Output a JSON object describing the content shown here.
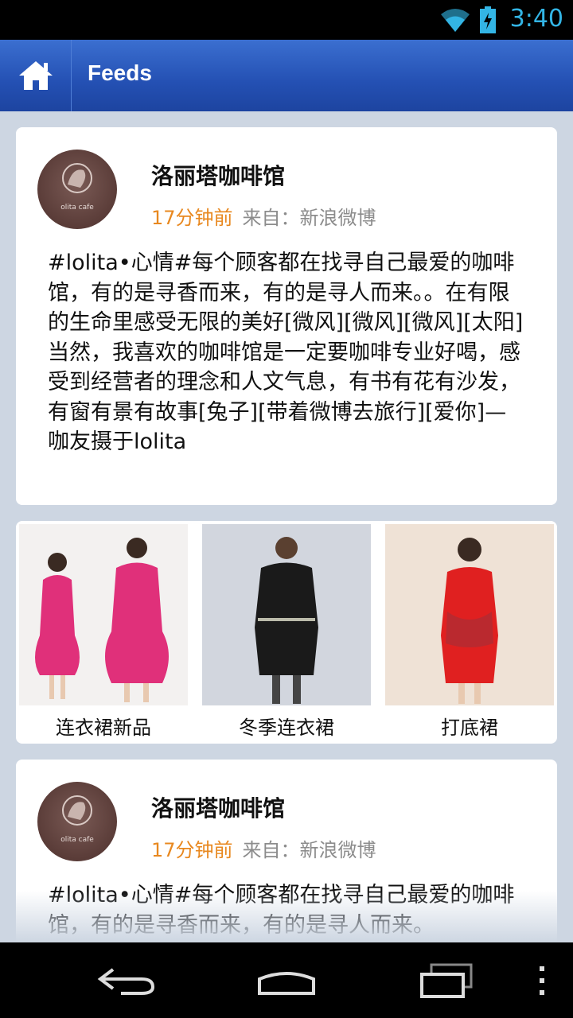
{
  "status_bar": {
    "time": "3:40"
  },
  "app_bar": {
    "title": "Feeds"
  },
  "posts": [
    {
      "name": "洛丽塔咖啡馆",
      "time": "17分钟前",
      "source": "来自：新浪微博",
      "body": "#lolita•心情#每个顾客都在找寻自己最爱的咖啡馆，有的是寻香而来，有的是寻人而来。。在有限的生命里感受无限的美好[微风][微风][微风][太阳]当然，我喜欢的咖啡馆是一定要咖啡专业好喝，感受到经营者的理念和人文气息，有书有花有沙发，有窗有景有故事[兔子][带着微博去旅行][爱你]—咖友摄于lolita"
    },
    {
      "name": "洛丽塔咖啡馆",
      "time": "17分钟前",
      "source": "来自：新浪微博",
      "body": "#lolita•心情#每个顾客都在找寻自己最爱的咖啡馆，有的是寻香而来，有的是寻人而来。"
    }
  ],
  "gallery": [
    {
      "label": "连衣裙新品",
      "color": "#e0307a"
    },
    {
      "label": "冬季连衣裙",
      "color": "#1a1a1a"
    },
    {
      "label": "打底裙",
      "color": "#e02020"
    }
  ],
  "avatar_logo": "olita cafe",
  "colors": {
    "accent": "#e8881f",
    "app_bar": "#2450b3",
    "status_accent": "#33b5e5"
  }
}
